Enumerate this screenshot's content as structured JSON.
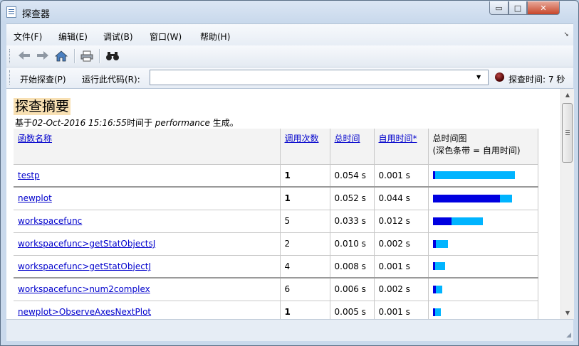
{
  "window": {
    "title": "探查器",
    "buttons": {
      "minimize": "▭",
      "maximize": "□",
      "close": "✕"
    }
  },
  "menu": [
    "文件(F)",
    "编辑(E)",
    "调试(B)",
    "窗口(W)",
    "帮助(H)"
  ],
  "runbar": {
    "start_label": "开始探查(P)",
    "run_code_label": "运行此代码(R):",
    "code_value": "",
    "time_label": "探查时间: 7 秒"
  },
  "summary": {
    "title": "探查摘要",
    "subtitle_prefix": "基于",
    "subtitle_date": "02-Oct-2016 15:16:55",
    "subtitle_mid": "时间于",
    "subtitle_source": "performance",
    "subtitle_suffix": "生成。"
  },
  "table": {
    "headers": {
      "name": "函数名称",
      "calls": "调用次数",
      "total_time": "总时间",
      "self_time": "自用时间*",
      "plot_line1": "总时间图",
      "plot_line2": "(深色条带 = 自用时间)"
    },
    "rows": [
      {
        "name": "testp",
        "calls": "1",
        "total": "0.054 s",
        "self": "0.001 s",
        "total_v": 0.054,
        "self_v": 0.001,
        "bold_calls": true,
        "thick": true
      },
      {
        "name": "newplot",
        "calls": "1",
        "total": "0.052 s",
        "self": "0.044 s",
        "total_v": 0.052,
        "self_v": 0.044,
        "bold_calls": true,
        "thick": false
      },
      {
        "name": "workspacefunc",
        "calls": "5",
        "total": "0.033 s",
        "self": "0.012 s",
        "total_v": 0.033,
        "self_v": 0.012,
        "bold_calls": false,
        "thick": false
      },
      {
        "name": "workspacefunc>getStatObjectsJ",
        "calls": "2",
        "total": "0.010 s",
        "self": "0.002 s",
        "total_v": 0.01,
        "self_v": 0.002,
        "bold_calls": false,
        "thick": false
      },
      {
        "name": "workspacefunc>getStatObjectJ",
        "calls": "4",
        "total": "0.008 s",
        "self": "0.001 s",
        "total_v": 0.008,
        "self_v": 0.001,
        "bold_calls": false,
        "thick": true
      },
      {
        "name": "workspacefunc>num2complex",
        "calls": "6",
        "total": "0.006 s",
        "self": "0.002 s",
        "total_v": 0.006,
        "self_v": 0.002,
        "bold_calls": false,
        "thick": false
      },
      {
        "name": "newplot>ObserveAxesNextPlot",
        "calls": "1",
        "total": "0.005 s",
        "self": "0.001 s",
        "total_v": 0.005,
        "self_v": 0.001,
        "bold_calls": true,
        "thick": false
      }
    ]
  },
  "icons": [
    "back-arrow-icon",
    "forward-arrow-icon",
    "home-icon",
    "print-icon",
    "find-icon",
    "profile-time-indicator-icon"
  ],
  "colors": {
    "self_bar": "#0000e0",
    "total_bar": "#00b4ff",
    "link": "#0000cc",
    "title_highlight": "#f8e0b3"
  }
}
